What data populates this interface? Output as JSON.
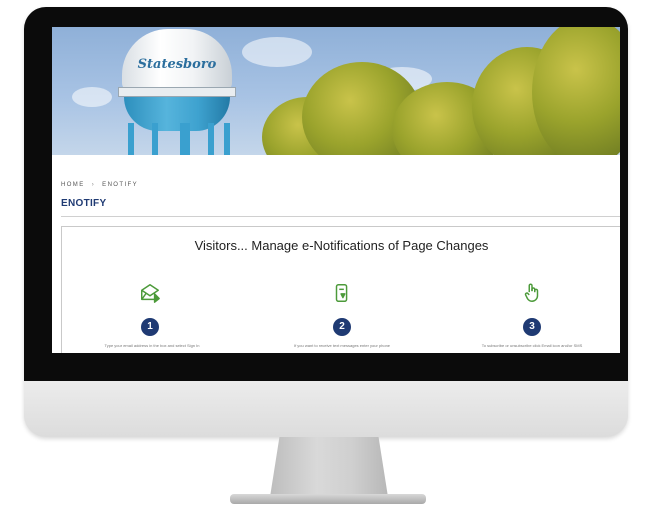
{
  "banner": {
    "tower_label": "Statesboro"
  },
  "breadcrumb": {
    "home": "HOME",
    "separator": "›",
    "current": "ENOTIFY"
  },
  "page": {
    "title": "ENOTIFY",
    "heading": "Visitors... Manage e-Notifications of Page Changes"
  },
  "steps": [
    {
      "number": "1",
      "icon": "email-envelope-icon",
      "text": "Type your email address in the box and select Sign In"
    },
    {
      "number": "2",
      "icon": "mobile-phone-icon",
      "text": "If you want to receive text messages enter your phone"
    },
    {
      "number": "3",
      "icon": "pointer-hand-icon",
      "text": "To subscribe or unsubscribe click Email icon and/or SMS"
    }
  ],
  "colors": {
    "title": "#1f3a73",
    "step_badge": "#1f3a73",
    "icon_green": "#4c9a3a"
  }
}
